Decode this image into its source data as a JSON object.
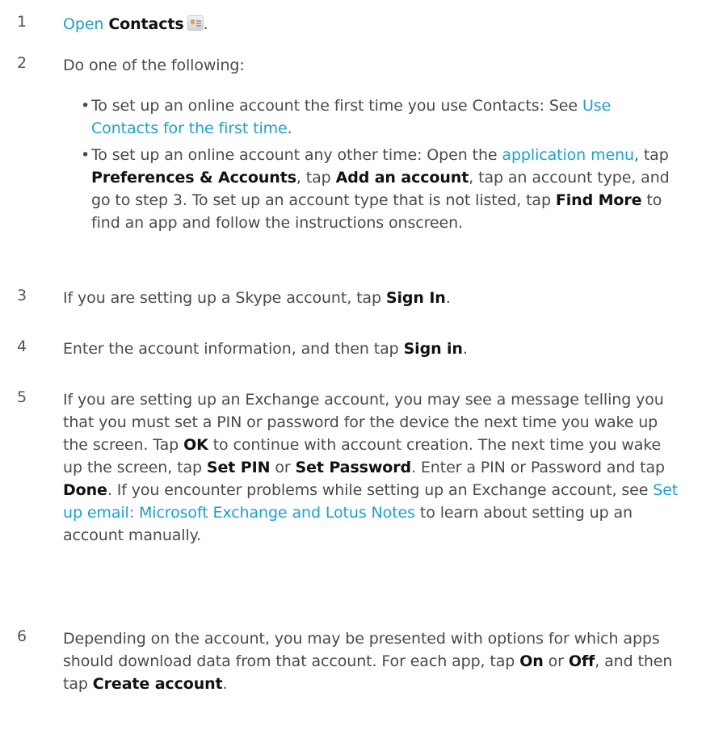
{
  "steps": [
    {
      "num": "1",
      "open_link": "Open",
      "open_app": "Contacts",
      "icon": "contacts-app-icon"
    },
    {
      "num": "2",
      "text": "Do one of the following:",
      "bullets": [
        {
          "pre": "To set up an online account the first time you use Contacts: See ",
          "link": "Use Contacts for the first time",
          "post": "."
        },
        {
          "pre": "To set up an online account any other time: Open the ",
          "link": "application menu",
          "t1": ", tap ",
          "b1": "Preferences & Accounts",
          "t2": ", tap ",
          "b2": "Add an account",
          "t3": ", tap an account type, and go to step 3. To set up an account type that is not listed, tap ",
          "b3": "Find More",
          "t4": " to find an app and follow the instructions onscreen."
        }
      ]
    },
    {
      "num": "3",
      "pre": "If you are setting up a Skype account, tap ",
      "bold": "Sign In",
      "post": "."
    },
    {
      "num": "4",
      "pre": "Enter the account information, and then tap ",
      "bold": "Sign in",
      "post": "."
    },
    {
      "num": "5",
      "t1": "If you are setting up an Exchange account, you may see a message telling you that you must set a PIN or password for the device the next time you wake up the screen. Tap ",
      "b1": "OK",
      "t2": " to continue with account creation. The next time you wake up the screen, tap ",
      "b2": "Set PIN",
      "t3": " or ",
      "b3": "Set Password",
      "t4": ". Enter a PIN or Password and tap ",
      "b4": "Done",
      "t5": ". If you encounter problems while setting up an Exchange account, see ",
      "link": "Set up email: Microsoft Exchange and Lotus Notes",
      "t6": " to learn about setting up an account manually."
    },
    {
      "num": "6",
      "t1": "Depending on the account, you may be presented with options for which apps should download data from that account. For each app, tap ",
      "b1": "On",
      "t2": " or ",
      "b2": "Off",
      "t3": ", and then tap ",
      "b3": "Create account",
      "t4": "."
    }
  ]
}
